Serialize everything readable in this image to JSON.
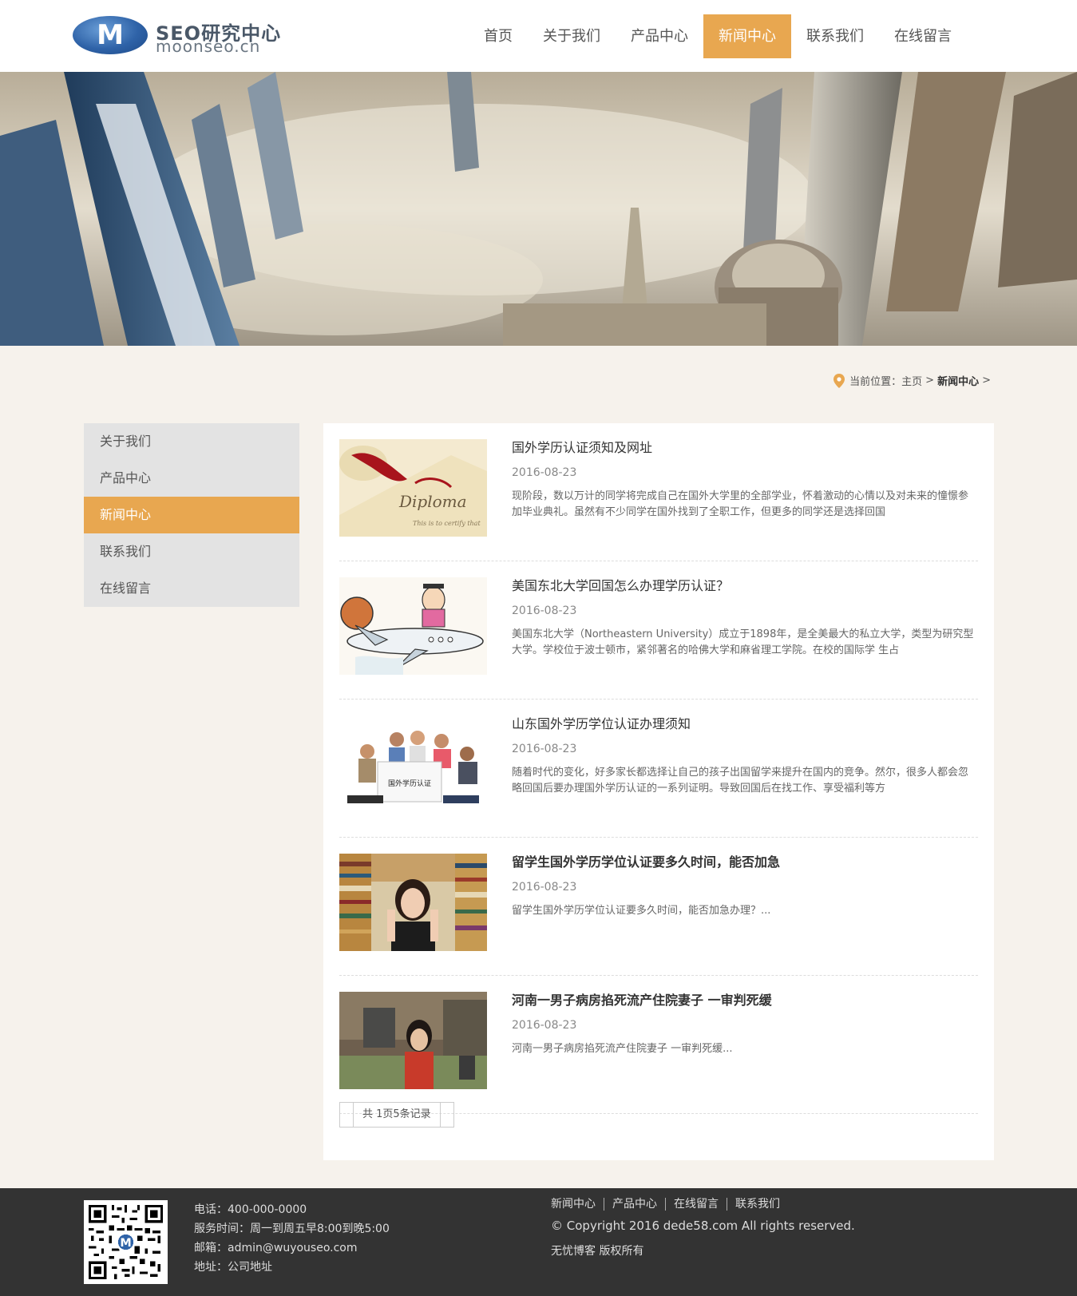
{
  "header": {
    "logo_title": "SEO研究中心",
    "logo_subtitle": "moonseo.cn",
    "nav": [
      {
        "label": "首页",
        "active": false
      },
      {
        "label": "关于我们",
        "active": false
      },
      {
        "label": "产品中心",
        "active": false
      },
      {
        "label": "新闻中心",
        "active": true
      },
      {
        "label": "联系我们",
        "active": false
      },
      {
        "label": "在线留言",
        "active": false
      }
    ]
  },
  "breadcrumb": {
    "prefix": "当前位置：",
    "items": [
      "主页",
      "新闻中心"
    ],
    "separator": ">"
  },
  "sidebar": {
    "items": [
      {
        "label": "关于我们",
        "active": false
      },
      {
        "label": "产品中心",
        "active": false
      },
      {
        "label": "新闻中心",
        "active": true
      },
      {
        "label": "联系我们",
        "active": false
      },
      {
        "label": "在线留言",
        "active": false
      }
    ]
  },
  "news": [
    {
      "title": "国外学历认证须知及网址",
      "date": "2016-08-23",
      "summary": "现阶段，数以万计的同学将完成自己在国外大学里的全部学业，怀着激动的心情以及对未来的憧憬参加毕业典礼。虽然有不少同学在国外找到了全职工作，但更多的同学还是选择回国",
      "thumb_label": "Diploma",
      "bold": false
    },
    {
      "title": "美国东北大学回国怎么办理学历认证？",
      "date": "2016-08-23",
      "summary": "美国东北大学（Northeastern University）成立于1898年，是全美最大的私立大学，类型为研究型大学。学校位于波士顿市，紧邻著名的哈佛大学和麻省理工学院。在校的国际学 生占",
      "thumb_label": "",
      "bold": false
    },
    {
      "title": "山东国外学历学位认证办理须知",
      "date": "2016-08-23",
      "summary": "随着时代的变化，好多家长都选择让自己的孩子出国留学来提升在国内的竞争。然尔，很多人都会忽略回国后要办理国外学历认证的一系列证明。导致回国后在找工作、享受福利等方",
      "thumb_label": "国外学历认证",
      "bold": false
    },
    {
      "title": "留学生国外学历学位认证要多久时间，能否加急",
      "date": "2016-08-23",
      "summary": "留学生国外学历学位认证要多久时间，能否加急办理？...",
      "thumb_label": "",
      "bold": true
    },
    {
      "title": "河南一男子病房掐死流产住院妻子 一审判死缓",
      "date": "2016-08-23",
      "summary": "河南一男子病房掐死流产住院妻子 一审判死缓...",
      "thumb_label": "",
      "bold": true
    }
  ],
  "pagination": {
    "text": "共 1页5条记录"
  },
  "footer": {
    "phone": "电话：400-000-0000",
    "hours": "服务时间：周一到周五早8:00到晚5:00",
    "email": "邮箱：admin@wuyouseo.com",
    "address": "地址：公司地址",
    "links": [
      "新闻中心",
      "产品中心",
      "在线留言",
      "联系我们"
    ],
    "copyright": "© Copyright 2016 dede58.com All rights reserved.",
    "owner": "无忧博客 版权所有"
  },
  "colors": {
    "accent": "#e8a750",
    "footer_bg": "#333333",
    "page_bg": "#f6f2ec"
  }
}
